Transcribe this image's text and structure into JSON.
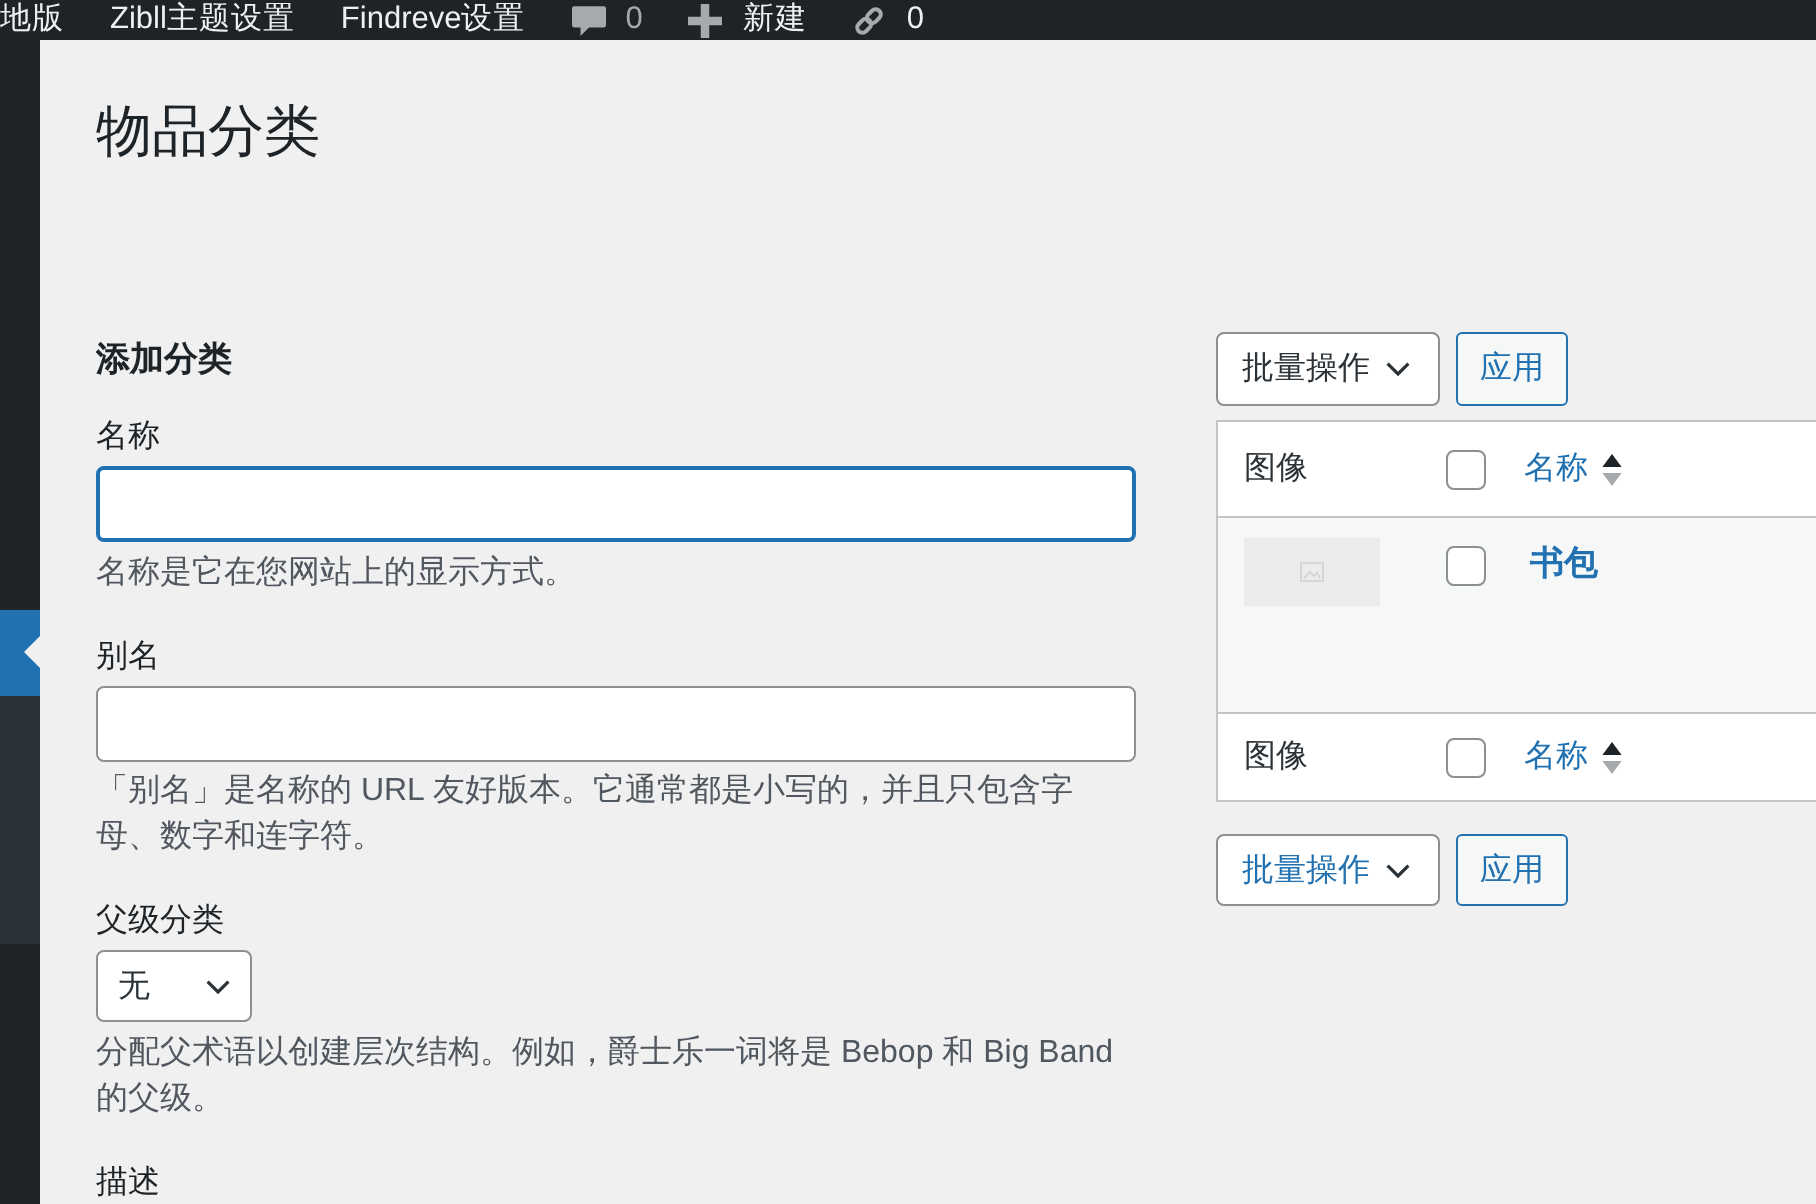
{
  "admin_bar": {
    "items": [
      {
        "kind": "text",
        "label": "地版"
      },
      {
        "kind": "text",
        "label": "Zibll主题设置"
      },
      {
        "kind": "text",
        "label": "Findreve设置"
      },
      {
        "kind": "comments",
        "label": "0"
      },
      {
        "kind": "new",
        "label": "新建"
      },
      {
        "kind": "links",
        "label": "0"
      }
    ]
  },
  "sidebar": {
    "items": [
      {
        "selected": true,
        "expanded": true
      }
    ]
  },
  "title": "物品分类",
  "add_form": {
    "heading": "添加分类",
    "fields": [
      {
        "kind": "text",
        "label": "名称",
        "focused": true,
        "help": "名称是它在您网站上的显示方式。"
      },
      {
        "kind": "text",
        "label": "别名",
        "focused": false,
        "help": "「别名」是名称的 URL 友好版本。它通常都是小写的，并且只包含字母、数字和连字符。"
      },
      {
        "kind": "select",
        "label": "父级分类",
        "value": "无",
        "help": "分配父术语以创建层次结构。例如，爵士乐一词将是 Bebop 和 Big Band 的父级。"
      },
      {
        "kind": "label",
        "label": "描述"
      }
    ]
  },
  "list": {
    "bulk_actions_top": {
      "label": "批量操作",
      "highlighted": false,
      "apply": "应用"
    },
    "table": {
      "header": [
        {
          "kind": "text",
          "label": "图像"
        },
        {
          "kind": "checkbox",
          "checked": false
        },
        {
          "kind": "sort_link",
          "label": "名称",
          "ascending": true
        }
      ],
      "rows": [
        {
          "checked": false,
          "name": "书包"
        }
      ],
      "footer": [
        {
          "kind": "text",
          "label": "图像"
        },
        {
          "kind": "checkbox",
          "checked": false
        },
        {
          "kind": "sort_link",
          "label": "名称",
          "ascending": true
        }
      ]
    },
    "bulk_actions_bottom": {
      "label": "批量操作",
      "highlighted": true,
      "apply": "应用"
    }
  }
}
